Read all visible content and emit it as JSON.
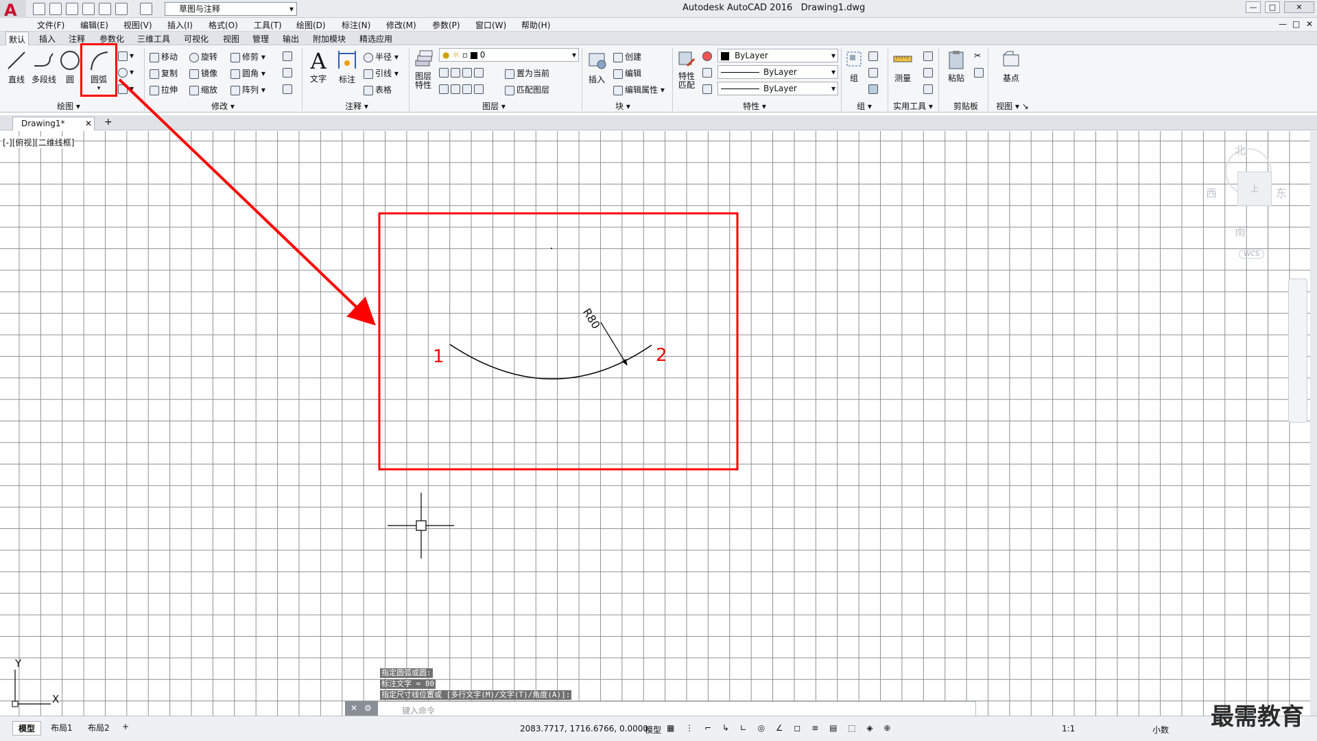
{
  "app": {
    "title": "Autodesk AutoCAD 2016",
    "file": "Drawing1.dwg",
    "workspace": "草图与注释",
    "logo": "A"
  },
  "window_controls": [
    "—",
    "□",
    "✕"
  ],
  "menus": [
    "文件(F)",
    "编辑(E)",
    "视图(V)",
    "插入(I)",
    "格式(O)",
    "工具(T)",
    "绘图(D)",
    "标注(N)",
    "修改(M)",
    "参数(P)",
    "窗口(W)",
    "帮助(H)"
  ],
  "ribbon_tabs": [
    "默认",
    "插入",
    "注释",
    "参数化",
    "三维工具",
    "可视化",
    "视图",
    "管理",
    "输出",
    "附加模块",
    "精选应用"
  ],
  "draw": {
    "line": "直线",
    "polyline": "多段线",
    "circle": "圆",
    "arc": "圆弧",
    "panel": "绘图"
  },
  "modify": {
    "move": "移动",
    "rotate": "旋转",
    "trim": "修剪",
    "copy": "复制",
    "mirror": "镜像",
    "fillet": "圆角",
    "stretch": "拉伸",
    "scale": "缩放",
    "array": "阵列",
    "panel": "修改"
  },
  "annotate": {
    "text": "文字",
    "dim": "标注",
    "radius": "半径",
    "leader": "引线",
    "table": "表格",
    "panel": "注释"
  },
  "layers": {
    "props": "图层\n特性",
    "current": "0",
    "set_current": "置为当前",
    "match": "匹配图层",
    "panel": "图层"
  },
  "block": {
    "insert": "插入",
    "create": "创建",
    "edit": "编辑",
    "edit_attr": "编辑属性",
    "panel": "块"
  },
  "properties": {
    "match": "特性\n匹配",
    "color": "ByLayer",
    "linetype": "ByLayer",
    "lineweight": "ByLayer",
    "panel": "特性"
  },
  "groups": {
    "group": "组",
    "panel": "组"
  },
  "utilities": {
    "measure": "测量",
    "panel": "实用工具"
  },
  "clipboard": {
    "paste": "粘贴",
    "panel": "剪贴板"
  },
  "view": {
    "base": "基点",
    "panel": "视图"
  },
  "doc_tab": "Drawing1*",
  "viewport_label": "[-][俯视][二维线框]",
  "drawing": {
    "dim_text": "R80",
    "point1": "1",
    "point2": "2"
  },
  "ucs": {
    "x": "X",
    "y": "Y"
  },
  "viewcube": {
    "north": "北",
    "south": "南",
    "east": "东",
    "west": "西",
    "face": "上",
    "wcs": "WCS"
  },
  "command_history": [
    "指定圆弧或圆:",
    "标注文字 = 80",
    "指定尺寸线位置或 [多行文字(M)/文字(T)/角度(A)]:"
  ],
  "command_placeholder": "键入命令",
  "layout_tabs": [
    "模型",
    "布局1",
    "布局2"
  ],
  "status": {
    "coords": "2083.7717, 1716.6766, 0.0000",
    "model": "模型",
    "scale": "1:1",
    "units": "小数"
  },
  "watermark": "最需教育",
  "colors": {
    "highlight": "#ff0000",
    "grid": "#8f8f8f",
    "brand": "#c8102e"
  }
}
